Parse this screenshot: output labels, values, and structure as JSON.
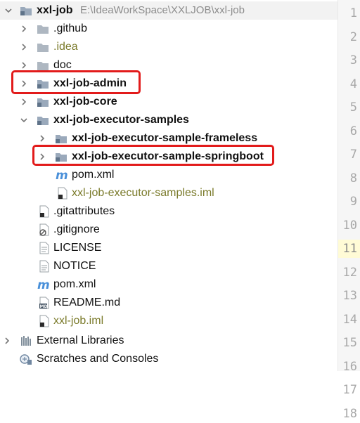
{
  "project_tree": {
    "root": {
      "name": "xxl-job",
      "path": "E:\\IdeaWorkSpace\\XXLJOB\\xxl-job"
    },
    "items": [
      {
        "label": ".github"
      },
      {
        "label": ".idea"
      },
      {
        "label": "doc"
      },
      {
        "label": "xxl-job-admin",
        "highlighted": true
      },
      {
        "label": "xxl-job-core"
      },
      {
        "label": "xxl-job-executor-samples"
      },
      {
        "label": "xxl-job-executor-sample-frameless"
      },
      {
        "label": "xxl-job-executor-sample-springboot",
        "highlighted": true
      },
      {
        "label": "pom.xml"
      },
      {
        "label": "xxl-job-executor-samples.iml"
      },
      {
        "label": ".gitattributes"
      },
      {
        "label": ".gitignore"
      },
      {
        "label": "LICENSE"
      },
      {
        "label": "NOTICE"
      },
      {
        "label": "pom.xml"
      },
      {
        "label": "README.md"
      },
      {
        "label": "xxl-job.iml"
      },
      {
        "label": "External Libraries"
      },
      {
        "label": "Scratches and Consoles"
      }
    ]
  },
  "editor_gutter": {
    "line_numbers": [
      "1",
      "2",
      "3",
      "4",
      "5",
      "6",
      "7",
      "8",
      "9",
      "10",
      "11",
      "12",
      "13",
      "14",
      "15",
      "16",
      "17",
      "18"
    ],
    "current_line": "11"
  },
  "colors": {
    "highlight_box": "#e21b1b",
    "module_folder": "#9aa9bb",
    "maven_icon": "#4a90d9"
  }
}
